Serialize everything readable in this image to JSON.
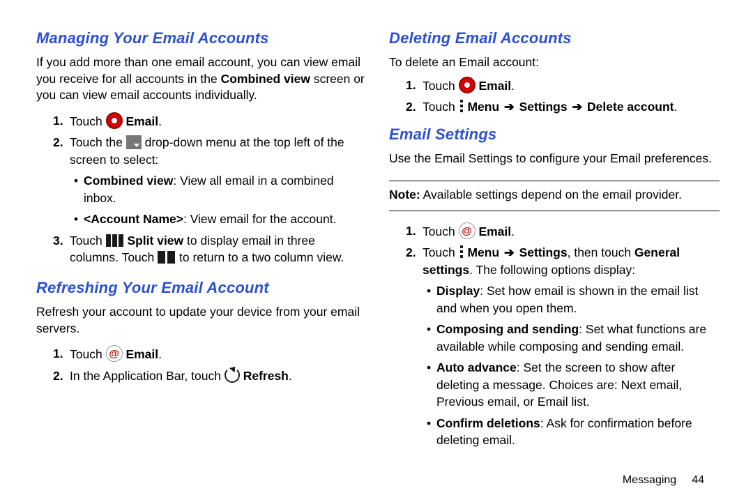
{
  "left": {
    "section1": {
      "title": "Managing Your Email Accounts",
      "intro_a": "If you add more than one email account, you can view email you receive for all accounts in the ",
      "intro_bold": "Combined view",
      "intro_b": " screen or you can view email accounts individually.",
      "step1_a": "Touch ",
      "step1_bold": "Email",
      "step1_b": ".",
      "step2_a": "Touch the ",
      "step2_b": " drop-down menu at the top left of the screen to select:",
      "bullet1_bold": "Combined view",
      "bullet1_rest": ": View all email in a combined inbox.",
      "bullet2_bold": "<Account Name>",
      "bullet2_rest": ": View email for the account.",
      "step3_a": "Touch ",
      "step3_bold": "Split view",
      "step3_b": " to display email in three columns. Touch ",
      "step3_c": " to return to a two column view."
    },
    "section2": {
      "title": "Refreshing Your Email Account",
      "intro": "Refresh your account to update your device from your email servers.",
      "step1_a": "Touch ",
      "step1_bold": "Email",
      "step1_b": ".",
      "step2_a": "In the Application Bar, touch ",
      "step2_bold": "Refresh",
      "step2_b": "."
    }
  },
  "right": {
    "section3": {
      "title": "Deleting Email Accounts",
      "intro": "To delete an Email account:",
      "step1_a": "Touch ",
      "step1_bold": "Email",
      "step1_b": ".",
      "step2_a": "Touch ",
      "step2_m1": "Menu",
      "step2_m2": "Settings",
      "step2_m3": "Delete account",
      "step2_b": "."
    },
    "section4": {
      "title": "Email Settings",
      "intro": "Use the Email Settings to configure your Email preferences.",
      "note_label": "Note:",
      "note_text": " Available settings depend on the email provider.",
      "step1_a": "Touch ",
      "step1_bold": "Email",
      "step1_b": ".",
      "step2_a": "Touch ",
      "step2_m1": "Menu",
      "step2_m2": "Settings",
      "step2_mid": ", then touch ",
      "step2_gs": "General settings",
      "step2_end": ". The following options display:",
      "b1_bold": "Display",
      "b1_rest": ": Set how email is shown in the email list and when you open them.",
      "b2_bold": "Composing and sending",
      "b2_rest": ": Set what functions are available while composing and sending email.",
      "b3_bold": "Auto advance",
      "b3_rest": ": Set the screen to show after deleting a message. Choices are: Next email, Previous email, or Email list.",
      "b4_bold": "Confirm deletions",
      "b4_rest": ": Ask for confirmation before deleting email."
    }
  },
  "footer": {
    "chapter": "Messaging",
    "page": "44"
  },
  "arrow": "➔"
}
